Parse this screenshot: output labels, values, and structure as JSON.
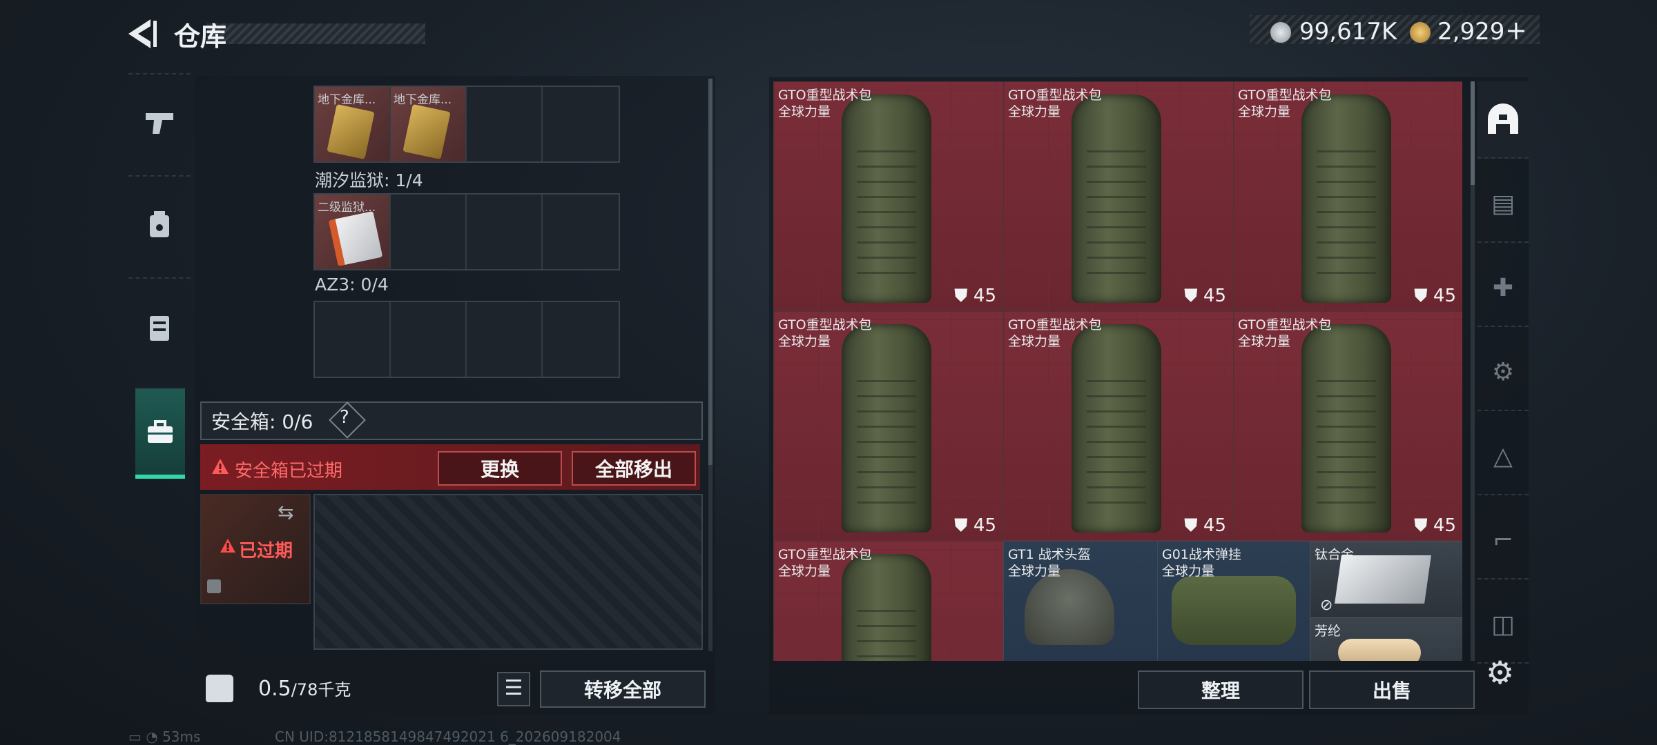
{
  "header": {
    "title": "仓库"
  },
  "currency": [
    {
      "icon": "silver-coin-icon",
      "value": "99,617K"
    },
    {
      "icon": "gold-coin-icon",
      "value": "2,929",
      "add": "+"
    }
  ],
  "left_tabs": [
    {
      "name": "weapons",
      "icon": "pistol-icon"
    },
    {
      "name": "armor",
      "icon": "chest-rig-icon"
    },
    {
      "name": "backpack",
      "icon": "vest-icon"
    },
    {
      "name": "safe-box",
      "icon": "briefcase-icon",
      "active": true
    }
  ],
  "keys": {
    "row1": [
      {
        "label": "地下金库..."
      },
      {
        "label": "地下金库..."
      }
    ],
    "section2_label": "潮汐监狱: 1/4",
    "row2": [
      {
        "label": "二级监狱..."
      }
    ],
    "section3_label": "AZ3: 0/4"
  },
  "safe_box": {
    "label": "安全箱: 0/6",
    "help": "?",
    "expired_warning": "安全箱已过期",
    "replace_label": "更换",
    "remove_all_label": "全部移出",
    "expired_tag": "已过期"
  },
  "weight": {
    "current": "0.5",
    "max": "/78千克"
  },
  "transfer_all_label": "转移全部",
  "inventory": [
    {
      "name": "GTO重型战术包",
      "faction": "全球力量",
      "durability": "45",
      "type": "backpack"
    },
    {
      "name": "GTO重型战术包",
      "faction": "全球力量",
      "durability": "45",
      "type": "backpack"
    },
    {
      "name": "GTO重型战术包",
      "faction": "全球力量",
      "durability": "45",
      "type": "backpack"
    },
    {
      "name": "GTO重型战术包",
      "faction": "全球力量",
      "durability": "45",
      "type": "backpack"
    },
    {
      "name": "GTO重型战术包",
      "faction": "全球力量",
      "durability": "45",
      "type": "backpack"
    },
    {
      "name": "GTO重型战术包",
      "faction": "全球力量",
      "durability": "45",
      "type": "backpack"
    },
    {
      "name": "GTO重型战术包",
      "faction": "全球力量",
      "durability": "",
      "type": "backpack"
    },
    {
      "name": "GT1 战术头盔",
      "faction": "全球力量",
      "durability": "",
      "type": "helmet"
    },
    {
      "name": "G01战术弹挂",
      "faction": "全球力量",
      "durability": "",
      "type": "rig"
    },
    {
      "name": "钛合金",
      "faction": "",
      "durability": "",
      "type": "material"
    },
    {
      "name": "芳纶",
      "faction": "",
      "durability": "",
      "type": "material"
    }
  ],
  "buttons": {
    "sort": "整理",
    "sell": "出售"
  },
  "right_tabs": [
    {
      "icon": "helmet-icon",
      "active": true
    },
    {
      "icon": "tier4-folder-icon"
    },
    {
      "icon": "tier4-medkit-icon"
    },
    {
      "icon": "tier4-tool-icon"
    },
    {
      "icon": "tier3-ammo-icon"
    },
    {
      "icon": "tier3-weapon-icon"
    },
    {
      "icon": "tier3-misc-icon"
    }
  ],
  "status": {
    "ping": "53ms",
    "uid": "CN UID:8121858149847492021 6_202609182004"
  }
}
